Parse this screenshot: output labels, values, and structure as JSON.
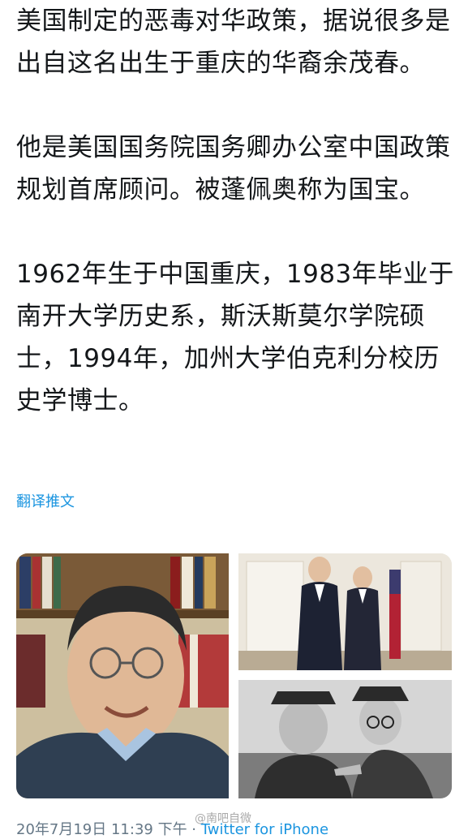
{
  "tweet": {
    "paragraphs": [
      "美国制定的恶毒对华政策，据说很多是出自这名出生于重庆的华裔余茂春。",
      "他是美国国务院国务卿办公室中国政策规划首席顾问。被蓬佩奥称为国宝。",
      "1962年生于中国重庆，1983年毕业于南开大学历史系，斯沃斯莫尔学院硕士，1994年，加州大学伯克利分校历史学博士。"
    ],
    "translate_label": "翻译推文"
  },
  "media": {
    "photos": [
      {
        "description_icon": "portrait-photo"
      },
      {
        "description_icon": "group-photo"
      },
      {
        "description_icon": "historical-photo"
      }
    ]
  },
  "meta": {
    "timestamp": "20年7月19日 11:39 下午",
    "separator": " · ",
    "source": "Twitter for iPhone"
  },
  "watermark": "@南吧自微"
}
